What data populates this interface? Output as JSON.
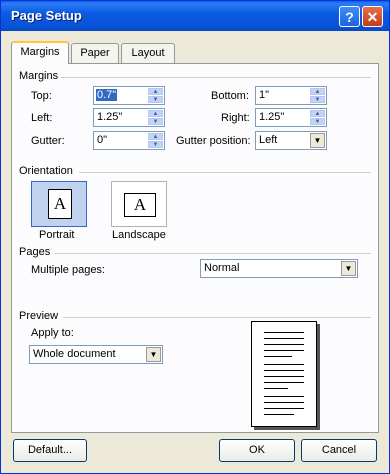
{
  "window": {
    "title": "Page Setup"
  },
  "tabs": [
    {
      "label": "Margins"
    },
    {
      "label": "Paper"
    },
    {
      "label": "Layout"
    }
  ],
  "margins": {
    "group_label": "Margins",
    "top": {
      "label": "Top:",
      "value": "0.7\""
    },
    "bottom": {
      "label": "Bottom:",
      "value": "1\""
    },
    "left": {
      "label": "Left:",
      "value": "1.25\""
    },
    "right": {
      "label": "Right:",
      "value": "1.25\""
    },
    "gutter": {
      "label": "Gutter:",
      "value": "0\""
    },
    "gutter_position": {
      "label": "Gutter position:",
      "value": "Left"
    }
  },
  "orientation": {
    "group_label": "Orientation",
    "portrait": {
      "label": "Portrait",
      "icon_text": "A",
      "selected": true
    },
    "landscape": {
      "label": "Landscape",
      "icon_text": "A",
      "selected": false
    }
  },
  "pages": {
    "group_label": "Pages",
    "multiple_pages_label": "Multiple pages:",
    "multiple_pages_value": "Normal"
  },
  "preview": {
    "group_label": "Preview",
    "apply_to_label": "Apply to:",
    "apply_to_value": "Whole document"
  },
  "buttons": {
    "default": "Default...",
    "ok": "OK",
    "cancel": "Cancel"
  }
}
